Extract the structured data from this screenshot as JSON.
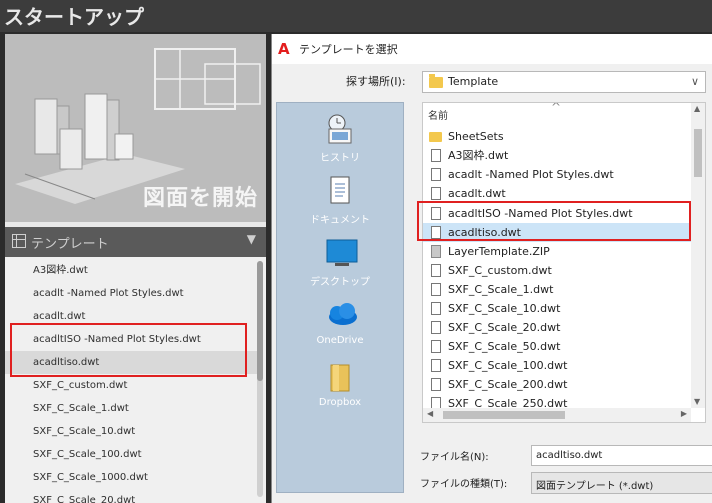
{
  "header": {
    "title": "スタートアップ"
  },
  "hero": {
    "label": "図面を開始"
  },
  "template_panel": {
    "title": "テンプレート",
    "items": [
      "A3図枠.dwt",
      "acadlt -Named Plot Styles.dwt",
      "acadlt.dwt",
      "acadltISO -Named Plot Styles.dwt",
      "acadltiso.dwt",
      "SXF_C_custom.dwt",
      "SXF_C_Scale_1.dwt",
      "SXF_C_Scale_10.dwt",
      "SXF_C_Scale_100.dwt",
      "SXF_C_Scale_1000.dwt",
      "SXF_C_Scale_20.dwt"
    ],
    "selected_index": 4
  },
  "dialog": {
    "title": "テンプレートを選択",
    "look_in_label": "探す場所(I):",
    "look_in_value": "Template",
    "column_header": "名前",
    "places": [
      "ヒストリ",
      "ドキュメント",
      "デスクトップ",
      "OneDrive",
      "Dropbox"
    ],
    "files": [
      {
        "name": "SheetSets",
        "type": "folder"
      },
      {
        "name": "A3図枠.dwt",
        "type": "file"
      },
      {
        "name": "acadlt -Named Plot Styles.dwt",
        "type": "file"
      },
      {
        "name": "acadlt.dwt",
        "type": "file"
      },
      {
        "name": "acadltISO -Named Plot Styles.dwt",
        "type": "file"
      },
      {
        "name": "acadltiso.dwt",
        "type": "file"
      },
      {
        "name": "LayerTemplate.ZIP",
        "type": "zip"
      },
      {
        "name": "SXF_C_custom.dwt",
        "type": "file"
      },
      {
        "name": "SXF_C_Scale_1.dwt",
        "type": "file"
      },
      {
        "name": "SXF_C_Scale_10.dwt",
        "type": "file"
      },
      {
        "name": "SXF_C_Scale_20.dwt",
        "type": "file"
      },
      {
        "name": "SXF_C_Scale_50.dwt",
        "type": "file"
      },
      {
        "name": "SXF_C_Scale_100.dwt",
        "type": "file"
      },
      {
        "name": "SXF_C_Scale_200.dwt",
        "type": "file"
      },
      {
        "name": "SXF_C_Scale_250.dwt",
        "type": "file"
      }
    ],
    "selected_file_index": 5,
    "file_name_label": "ファイル名(N):",
    "file_name_value": "acadltiso.dwt",
    "file_type_label": "ファイルの種類(T):",
    "file_type_value": "図面テンプレート (*.dwt)"
  },
  "colors": {
    "highlight": "#e02020",
    "selection": "#cce4f7",
    "places_bg": "#b9cbdc"
  }
}
